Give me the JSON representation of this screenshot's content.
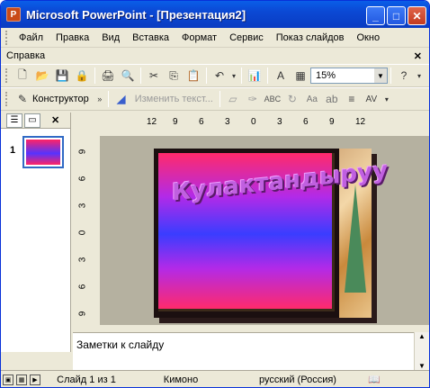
{
  "window": {
    "title": "Microsoft PowerPoint - [Презентация2]",
    "app_icon_letter": "P"
  },
  "menu": {
    "items": [
      "Файл",
      "Правка",
      "Вид",
      "Вставка",
      "Формат",
      "Сервис",
      "Показ слайдов",
      "Окно"
    ],
    "help": "Справка"
  },
  "toolbar": {
    "zoom_value": "15%",
    "designer_label": "Конструктор",
    "new_text_label": "Изменить текст..."
  },
  "rulers": {
    "horizontal": [
      "12",
      "9",
      "6",
      "3",
      "0",
      "3",
      "6",
      "9",
      "12"
    ],
    "vertical": [
      "9",
      "6",
      "3",
      "0",
      "3",
      "6",
      "9"
    ]
  },
  "slides_panel": {
    "slide_number": "1"
  },
  "slide": {
    "wordart_text": "Кулактандыруу"
  },
  "notes": {
    "placeholder": "Заметки к слайду"
  },
  "status": {
    "slide_info": "Слайд 1 из 1",
    "design": "Кимоно",
    "language": "русский (Россия)"
  }
}
